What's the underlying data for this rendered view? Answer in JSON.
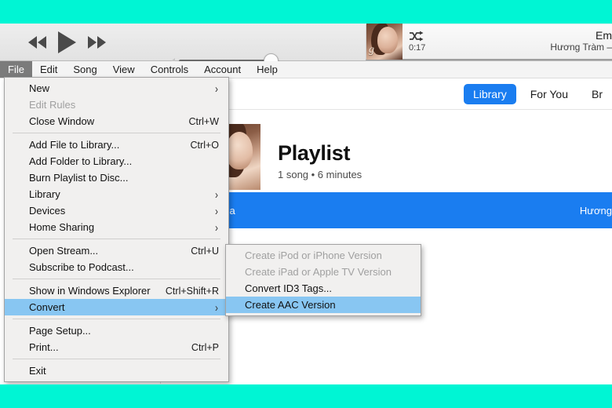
{
  "theme": {
    "frame_color": "#00f5d4",
    "accent_blue": "#1a7df0",
    "menu_highlight": "#88c6f2",
    "menubar_active_bg": "#7b7b7b"
  },
  "player": {
    "prev_icon": "rewind-icon",
    "play_icon": "play-icon",
    "next_icon": "fast-forward-icon",
    "volume_level": 80,
    "now_playing": {
      "shuffle_icon": "shuffle-icon",
      "elapsed": "0:17",
      "title": "Em",
      "subtitle": "Hương Tràm –"
    }
  },
  "menubar": {
    "items": [
      {
        "label": "File",
        "active": true
      },
      {
        "label": "Edit",
        "active": false
      },
      {
        "label": "Song",
        "active": false
      },
      {
        "label": "View",
        "active": false
      },
      {
        "label": "Controls",
        "active": false
      },
      {
        "label": "Account",
        "active": false
      },
      {
        "label": "Help",
        "active": false
      }
    ]
  },
  "file_menu": {
    "rows": [
      {
        "type": "item",
        "label": "New",
        "accel": "",
        "submenu": true,
        "disabled": false,
        "highlighted": false
      },
      {
        "type": "item",
        "label": "Edit Rules",
        "accel": "",
        "submenu": false,
        "disabled": true,
        "highlighted": false
      },
      {
        "type": "item",
        "label": "Close Window",
        "accel": "Ctrl+W",
        "submenu": false,
        "disabled": false,
        "highlighted": false
      },
      {
        "type": "separator"
      },
      {
        "type": "item",
        "label": "Add File to Library...",
        "accel": "Ctrl+O",
        "submenu": false,
        "disabled": false,
        "highlighted": false
      },
      {
        "type": "item",
        "label": "Add Folder to Library...",
        "accel": "",
        "submenu": false,
        "disabled": false,
        "highlighted": false
      },
      {
        "type": "item",
        "label": "Burn Playlist to Disc...",
        "accel": "",
        "submenu": false,
        "disabled": false,
        "highlighted": false
      },
      {
        "type": "item",
        "label": "Library",
        "accel": "",
        "submenu": true,
        "disabled": false,
        "highlighted": false
      },
      {
        "type": "item",
        "label": "Devices",
        "accel": "",
        "submenu": true,
        "disabled": false,
        "highlighted": false
      },
      {
        "type": "item",
        "label": "Home Sharing",
        "accel": "",
        "submenu": true,
        "disabled": false,
        "highlighted": false
      },
      {
        "type": "separator"
      },
      {
        "type": "item",
        "label": "Open Stream...",
        "accel": "Ctrl+U",
        "submenu": false,
        "disabled": false,
        "highlighted": false
      },
      {
        "type": "item",
        "label": "Subscribe to Podcast...",
        "accel": "",
        "submenu": false,
        "disabled": false,
        "highlighted": false
      },
      {
        "type": "separator"
      },
      {
        "type": "item",
        "label": "Show in Windows Explorer",
        "accel": "Ctrl+Shift+R",
        "submenu": false,
        "disabled": false,
        "highlighted": false
      },
      {
        "type": "item",
        "label": "Convert",
        "accel": "",
        "submenu": true,
        "disabled": false,
        "highlighted": true
      },
      {
        "type": "separator"
      },
      {
        "type": "item",
        "label": "Page Setup...",
        "accel": "",
        "submenu": false,
        "disabled": false,
        "highlighted": false
      },
      {
        "type": "item",
        "label": "Print...",
        "accel": "Ctrl+P",
        "submenu": false,
        "disabled": false,
        "highlighted": false
      },
      {
        "type": "separator"
      },
      {
        "type": "item",
        "label": "Exit",
        "accel": "",
        "submenu": false,
        "disabled": false,
        "highlighted": false
      }
    ]
  },
  "convert_submenu": {
    "rows": [
      {
        "label": "Create iPod or iPhone Version",
        "disabled": true,
        "highlighted": false
      },
      {
        "label": "Create iPad or Apple TV Version",
        "disabled": true,
        "highlighted": false
      },
      {
        "label": "Convert ID3 Tags...",
        "disabled": false,
        "highlighted": false
      },
      {
        "label": "Create AAC Version",
        "disabled": false,
        "highlighted": true
      }
    ]
  },
  "content": {
    "tabs": [
      {
        "label": "Library",
        "selected": true
      },
      {
        "label": "For You",
        "selected": false
      },
      {
        "label": "Br",
        "selected": false
      }
    ],
    "playlist": {
      "title": "Playlist",
      "subtitle": "1 song • 6 minutes"
    },
    "track": {
      "name": "Em Gái Mưa",
      "artist": "Hương"
    }
  }
}
